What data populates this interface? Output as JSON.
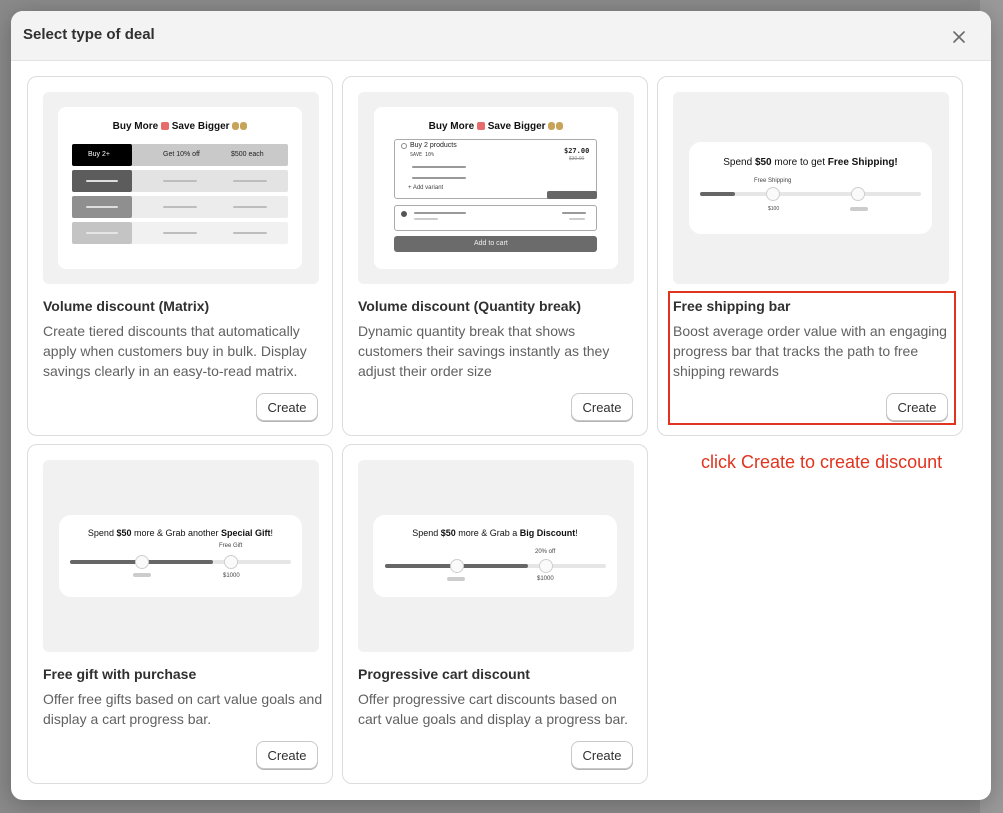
{
  "modal": {
    "title": "Select type of deal",
    "close_icon": "close-icon"
  },
  "cards": [
    {
      "title": "Volume discount (Matrix)",
      "description": "Create tiered discounts that automatically apply when customers buy in bulk. Display savings clearly in an easy-to-read matrix.",
      "button": "Create",
      "preview": {
        "heading": "Buy More 🛍️ Save Bigger 💰💰",
        "heading_text": "Buy More",
        "heading_text2": "Save Bigger",
        "col1": "Buy 2+",
        "col2": "Get 10% off",
        "col3": "$500 each"
      }
    },
    {
      "title": "Volume discount (Quantity break)",
      "description": "Dynamic quantity break that shows customers their savings instantly as they adjust their order size",
      "button": "Create",
      "preview": {
        "heading_text": "Buy More",
        "heading_text2": "Save Bigger",
        "option_label": "Buy 2 products",
        "option_save": "SAVE 10%",
        "price": "$27.00",
        "old_price": "$30.00",
        "add_variant": "+ Add variant",
        "add_to_cart": "Add to cart"
      }
    },
    {
      "title": "Free shipping bar",
      "description": "Boost average order value with an engaging progress bar that tracks the path to free shipping rewards",
      "button": "Create",
      "preview": {
        "heading_pre": "Spend ",
        "heading_amount": "$50",
        "heading_mid": " more to get ",
        "heading_bold": "Free Shipping!",
        "milestone_label": "Free Shipping",
        "milestone_value": "$100"
      }
    },
    {
      "title": "Free gift with purchase",
      "description": "Offer free gifts based on cart value goals and display a cart progress bar.",
      "button": "Create",
      "preview": {
        "heading_pre": "Spend ",
        "heading_amount": "$50",
        "heading_mid": " more & Grab another ",
        "heading_bold": "Special Gift",
        "heading_end": "!",
        "milestone_label": "Free Gift",
        "milestone_value": "$1000"
      }
    },
    {
      "title": "Progressive cart discount",
      "description": "Offer progressive cart discounts based on cart value goals and display a progress bar.",
      "button": "Create",
      "preview": {
        "heading_pre": "Spend ",
        "heading_amount": "$50",
        "heading_mid": " more & Grab a ",
        "heading_bold": "Big Discount",
        "heading_end": "!",
        "milestone_label": "20% off",
        "milestone_value": "$1000"
      }
    }
  ],
  "annotation": {
    "text": "click Create to create discount",
    "color": "#e0341f"
  }
}
